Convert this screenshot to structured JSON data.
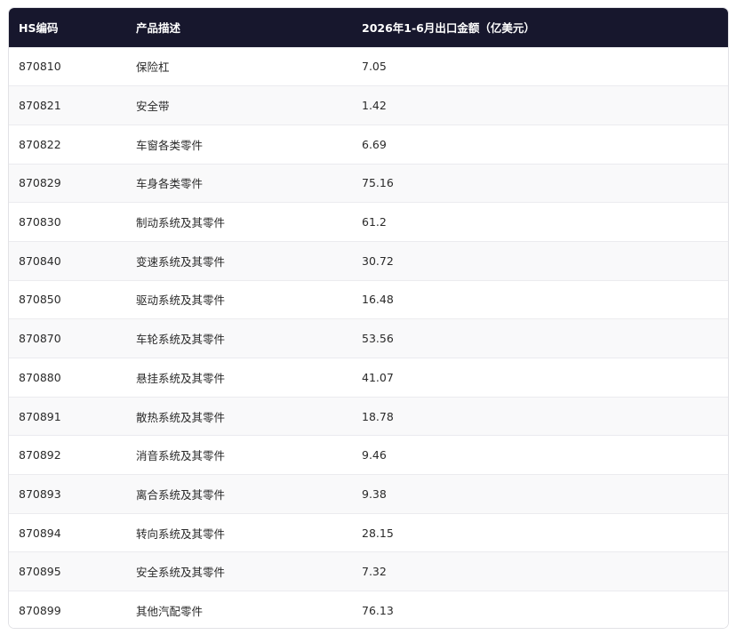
{
  "table": {
    "headers": [
      "HS编码",
      "产品描述",
      "2026年1-6月出口金额（亿美元）"
    ],
    "rows": [
      [
        "870810",
        "保险杠",
        "7.05"
      ],
      [
        "870821",
        "安全带",
        "1.42"
      ],
      [
        "870822",
        "车窗各类零件",
        "6.69"
      ],
      [
        "870829",
        "车身各类零件",
        "75.16"
      ],
      [
        "870830",
        "制动系统及其零件",
        "61.2"
      ],
      [
        "870840",
        "变速系统及其零件",
        "30.72"
      ],
      [
        "870850",
        "驱动系统及其零件",
        "16.48"
      ],
      [
        "870870",
        "车轮系统及其零件",
        "53.56"
      ],
      [
        "870880",
        "悬挂系统及其零件",
        "41.07"
      ],
      [
        "870891",
        "散热系统及其零件",
        "18.78"
      ],
      [
        "870892",
        "消音系统及其零件",
        "9.46"
      ],
      [
        "870893",
        "离合系统及其零件",
        "9.38"
      ],
      [
        "870894",
        "转向系统及其零件",
        "28.15"
      ],
      [
        "870895",
        "安全系统及其零件",
        "7.32"
      ],
      [
        "870899",
        "其他汽配零件",
        "76.13"
      ]
    ]
  },
  "colors": {
    "header_bg": "#17172d",
    "header_text": "#ffffff",
    "row_alt_bg": "#f9f9fa",
    "border": "#e2e2e6"
  }
}
